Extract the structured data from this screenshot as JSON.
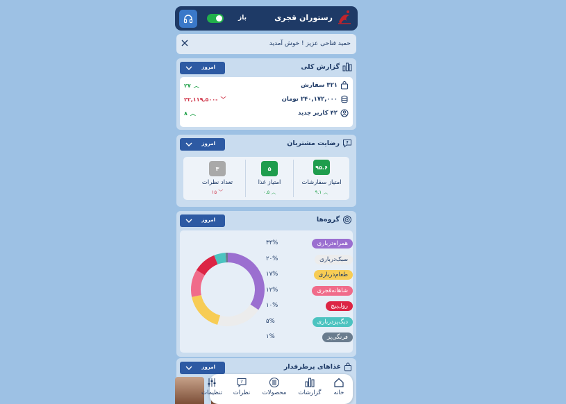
{
  "header": {
    "restaurant_name": "رستوران قجری",
    "status_label": "باز"
  },
  "welcome": {
    "message": "حمید فتاحی عزیز ! خوش آمدید"
  },
  "report": {
    "title": "گزارش کلی",
    "period": "امروز",
    "stats": [
      {
        "value": "۳۲۱ سفارش",
        "delta": "۲۷",
        "trend": "up",
        "icon": "bag-icon"
      },
      {
        "value": "۲۴۰,۱۷۲,۰۰۰ تومان",
        "delta": "-۲۲,۱۱۹,۵۰۰",
        "trend": "down",
        "icon": "coins-icon"
      },
      {
        "value": "۴۲ کاربر جدید",
        "delta": "۸",
        "trend": "up",
        "icon": "user-plus-icon"
      }
    ]
  },
  "satisfaction": {
    "title": "رضایت مشتریان",
    "period": "امروز",
    "metrics": [
      {
        "score": "۹۵.۶",
        "label": "امتیاز سفارشات",
        "delta": "۹.۱",
        "trend": "up",
        "color": "#1f9d4d"
      },
      {
        "score": "۵",
        "label": "امتیاز غذا",
        "delta": "۰.۵",
        "trend": "up",
        "color": "#1f9d4d"
      },
      {
        "score": "۳",
        "label": "تعداد نظرات",
        "delta": "۱۵",
        "trend": "down",
        "color": "#a9a9a9"
      }
    ]
  },
  "groups": {
    "title": "گروه‌ها",
    "period": "امروز",
    "chart_data": {
      "type": "pie",
      "categories": [
        "همراه‌درباری",
        "سبک‌درباری",
        "طعام‌درباری",
        "شاهانه‌قجری",
        "رول‌پیچ",
        "دیگ‌پزدرباری",
        "فرنگی‌پز"
      ],
      "values": [
        34,
        20,
        17,
        12,
        10,
        5,
        1
      ],
      "value_labels": [
        "۳۴%",
        "۲۰%",
        "۱۷%",
        "۱۲%",
        "۱۰%",
        "۵%",
        "۱%"
      ],
      "colors": [
        "#9b6fd0",
        "#ececec",
        "#f7cc55",
        "#f06b8a",
        "#dc2444",
        "#4cc3c0",
        "#6a7c8e"
      ],
      "text_colors": [
        "#fff",
        "#1e3a66",
        "#1e3a66",
        "#fff",
        "#fff",
        "#fff",
        "#fff"
      ]
    }
  },
  "popular": {
    "title": "غذاهای پرطرفدار",
    "period": "امروز"
  },
  "nav": {
    "items": [
      {
        "label": "خانه",
        "icon": "home-icon"
      },
      {
        "label": "گزارشات",
        "icon": "chart-icon"
      },
      {
        "label": "محصولات",
        "icon": "cutlery-icon"
      },
      {
        "label": "نظرات",
        "icon": "comment-icon"
      },
      {
        "label": "تنظیمات",
        "icon": "sliders-icon"
      }
    ]
  }
}
